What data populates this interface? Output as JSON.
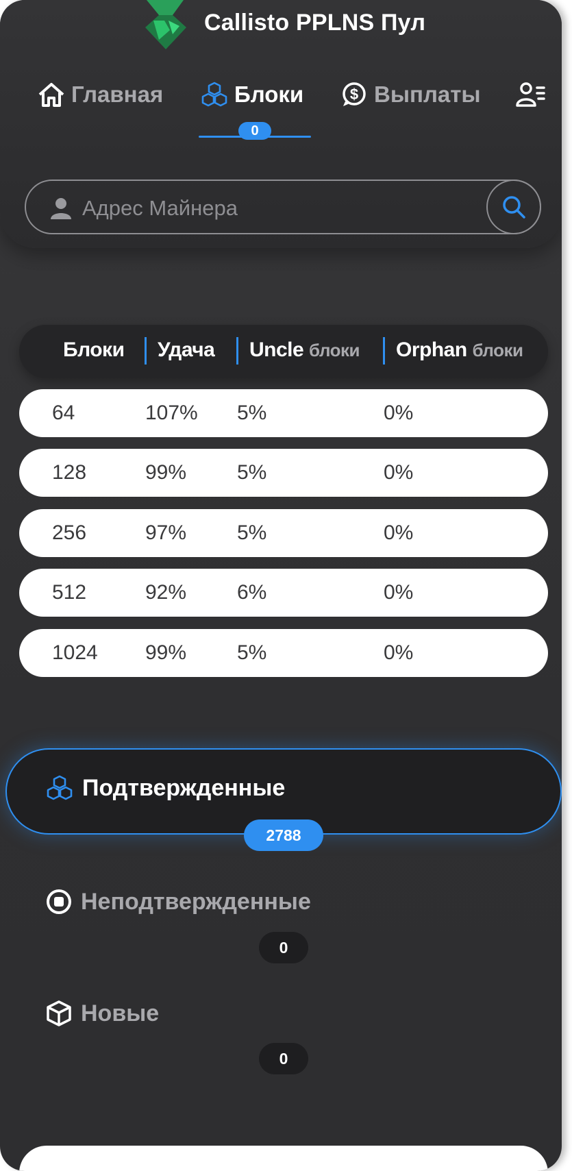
{
  "app": {
    "title": "Callisto PPLNS Пул"
  },
  "nav": {
    "items": [
      {
        "label": "Главная",
        "icon": "home-icon"
      },
      {
        "label": "Блоки",
        "icon": "cubes-icon",
        "active": true,
        "badge": "0"
      },
      {
        "label": "Выплаты",
        "icon": "dollar-chat-icon"
      },
      {
        "label": "",
        "icon": "users-icon"
      }
    ]
  },
  "search": {
    "placeholder": "Адрес Майнера"
  },
  "stats": {
    "headers": [
      {
        "main": "Блоки",
        "sub": ""
      },
      {
        "main": "Удача",
        "sub": ""
      },
      {
        "main": "Uncle",
        "sub": "блоки"
      },
      {
        "main": "Orphan",
        "sub": "блоки"
      }
    ],
    "rows": [
      [
        "64",
        "107%",
        "5%",
        "0%"
      ],
      [
        "128",
        "99%",
        "5%",
        "0%"
      ],
      [
        "256",
        "97%",
        "5%",
        "0%"
      ],
      [
        "512",
        "92%",
        "6%",
        "0%"
      ],
      [
        "1024",
        "99%",
        "5%",
        "0%"
      ]
    ]
  },
  "block_tabs": [
    {
      "label": "Подтвержденные",
      "count": "2788",
      "icon": "cubes-icon",
      "active": true
    },
    {
      "label": "Неподтвержденные",
      "count": "0",
      "icon": "stop-circle-icon"
    },
    {
      "label": "Новые",
      "count": "0",
      "icon": "cube-icon"
    }
  ],
  "colors": {
    "accent": "#2f8ff0",
    "background": "#333335",
    "card": "#ffffff",
    "text_muted": "#a9a9ad"
  }
}
